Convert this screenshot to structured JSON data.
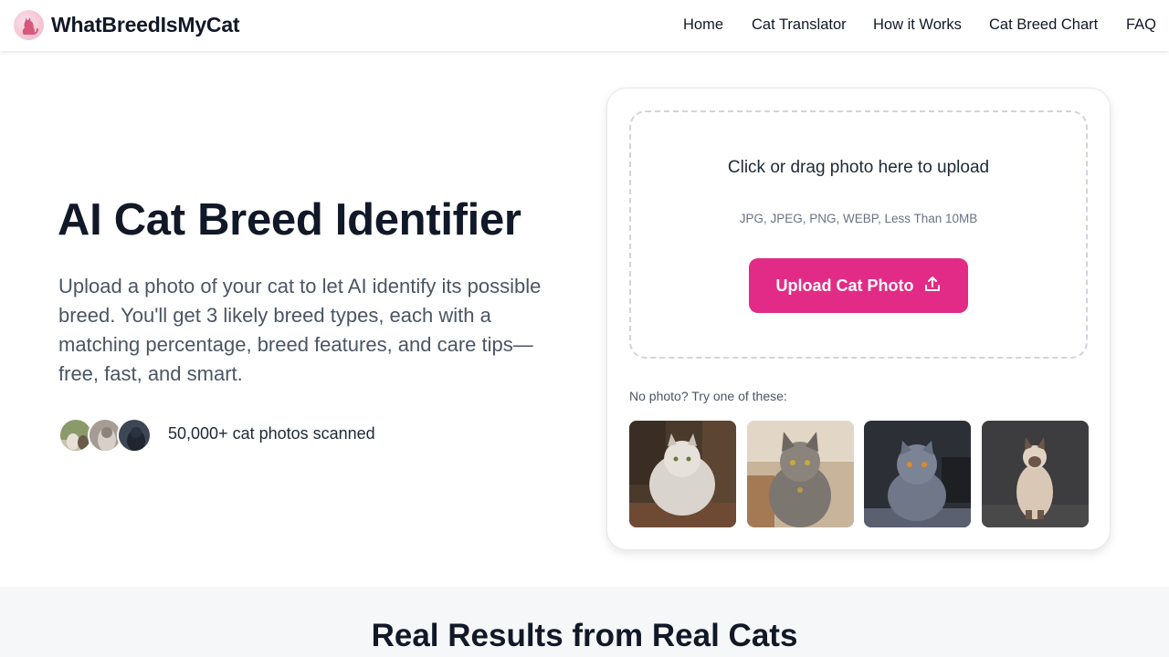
{
  "header": {
    "brand": "WhatBreedIsMyCat",
    "logo_icon": "cat-logo-icon",
    "nav": [
      {
        "label": "Home"
      },
      {
        "label": "Cat Translator"
      },
      {
        "label": "How it Works"
      },
      {
        "label": "Cat Breed Chart"
      },
      {
        "label": "FAQ"
      }
    ]
  },
  "hero": {
    "title": "AI Cat Breed Identifier",
    "description": "Upload a photo of your cat to let AI identify its possible breed. You'll get 3 likely breed types, each with a matching percentage, breed features, and care tips—free, fast, and smart.",
    "scanned": "50,000+ cat photos scanned"
  },
  "upload": {
    "title": "Click or drag photo here to upload",
    "hint": "JPG, JPEG, PNG, WEBP, Less Than 10MB",
    "button_label": "Upload Cat Photo",
    "button_icon": "upload-icon",
    "samples_label": "No photo? Try one of these:"
  },
  "section": {
    "title": "Real Results from Real Cats"
  },
  "colors": {
    "accent": "#e22b86",
    "text_dark": "#111827",
    "text_muted": "#4b5563",
    "band_bg": "#f6f7f9"
  }
}
